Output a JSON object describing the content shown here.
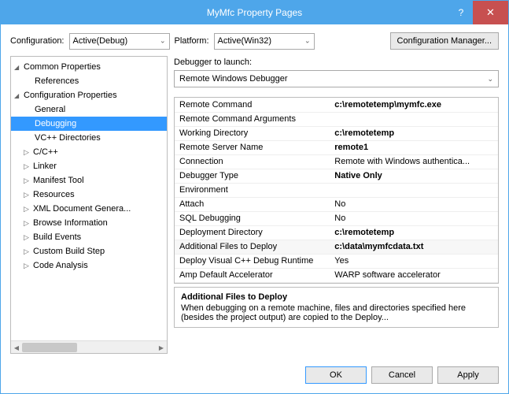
{
  "title": "MyMfc Property Pages",
  "toprow": {
    "config_label": "Configuration:",
    "config_value": "Active(Debug)",
    "platform_label": "Platform:",
    "platform_value": "Active(Win32)",
    "cfgmgr": "Configuration Manager..."
  },
  "tree": {
    "common": "Common Properties",
    "references": "References",
    "configprops": "Configuration Properties",
    "general": "General",
    "debugging": "Debugging",
    "vcdirs": "VC++ Directories",
    "cpp": "C/C++",
    "linker": "Linker",
    "manifest": "Manifest Tool",
    "resources": "Resources",
    "xmldoc": "XML Document Genera...",
    "browseinfo": "Browse Information",
    "buildevents": "Build Events",
    "custombuild": "Custom Build Step",
    "codeanalysis": "Code Analysis"
  },
  "launcher": {
    "label": "Debugger to launch:",
    "value": "Remote Windows Debugger"
  },
  "props": [
    {
      "k": "Remote Command",
      "v": "c:\\remotetemp\\mymfc.exe",
      "bold": true
    },
    {
      "k": "Remote Command Arguments",
      "v": ""
    },
    {
      "k": "Working Directory",
      "v": "c:\\remotetemp",
      "bold": true
    },
    {
      "k": "Remote Server Name",
      "v": "remote1",
      "bold": true
    },
    {
      "k": "Connection",
      "v": "Remote with Windows authentica..."
    },
    {
      "k": "Debugger Type",
      "v": "Native Only",
      "bold": true
    },
    {
      "k": "Environment",
      "v": ""
    },
    {
      "k": "Attach",
      "v": "No"
    },
    {
      "k": "SQL Debugging",
      "v": "No"
    },
    {
      "k": "Deployment Directory",
      "v": "c:\\remotetemp",
      "bold": true
    },
    {
      "k": "Additional Files to Deploy",
      "v": "c:\\data\\mymfcdata.txt",
      "bold": true,
      "highlight": true
    },
    {
      "k": "Deploy Visual C++ Debug Runtime",
      "v": "Yes"
    },
    {
      "k": "Amp Default Accelerator",
      "v": "WARP software accelerator"
    }
  ],
  "desc": {
    "title": "Additional Files to Deploy",
    "body": "When debugging on a remote machine, files and directories specified here (besides the project output) are copied to the Deploy..."
  },
  "buttons": {
    "ok": "OK",
    "cancel": "Cancel",
    "apply": "Apply"
  }
}
